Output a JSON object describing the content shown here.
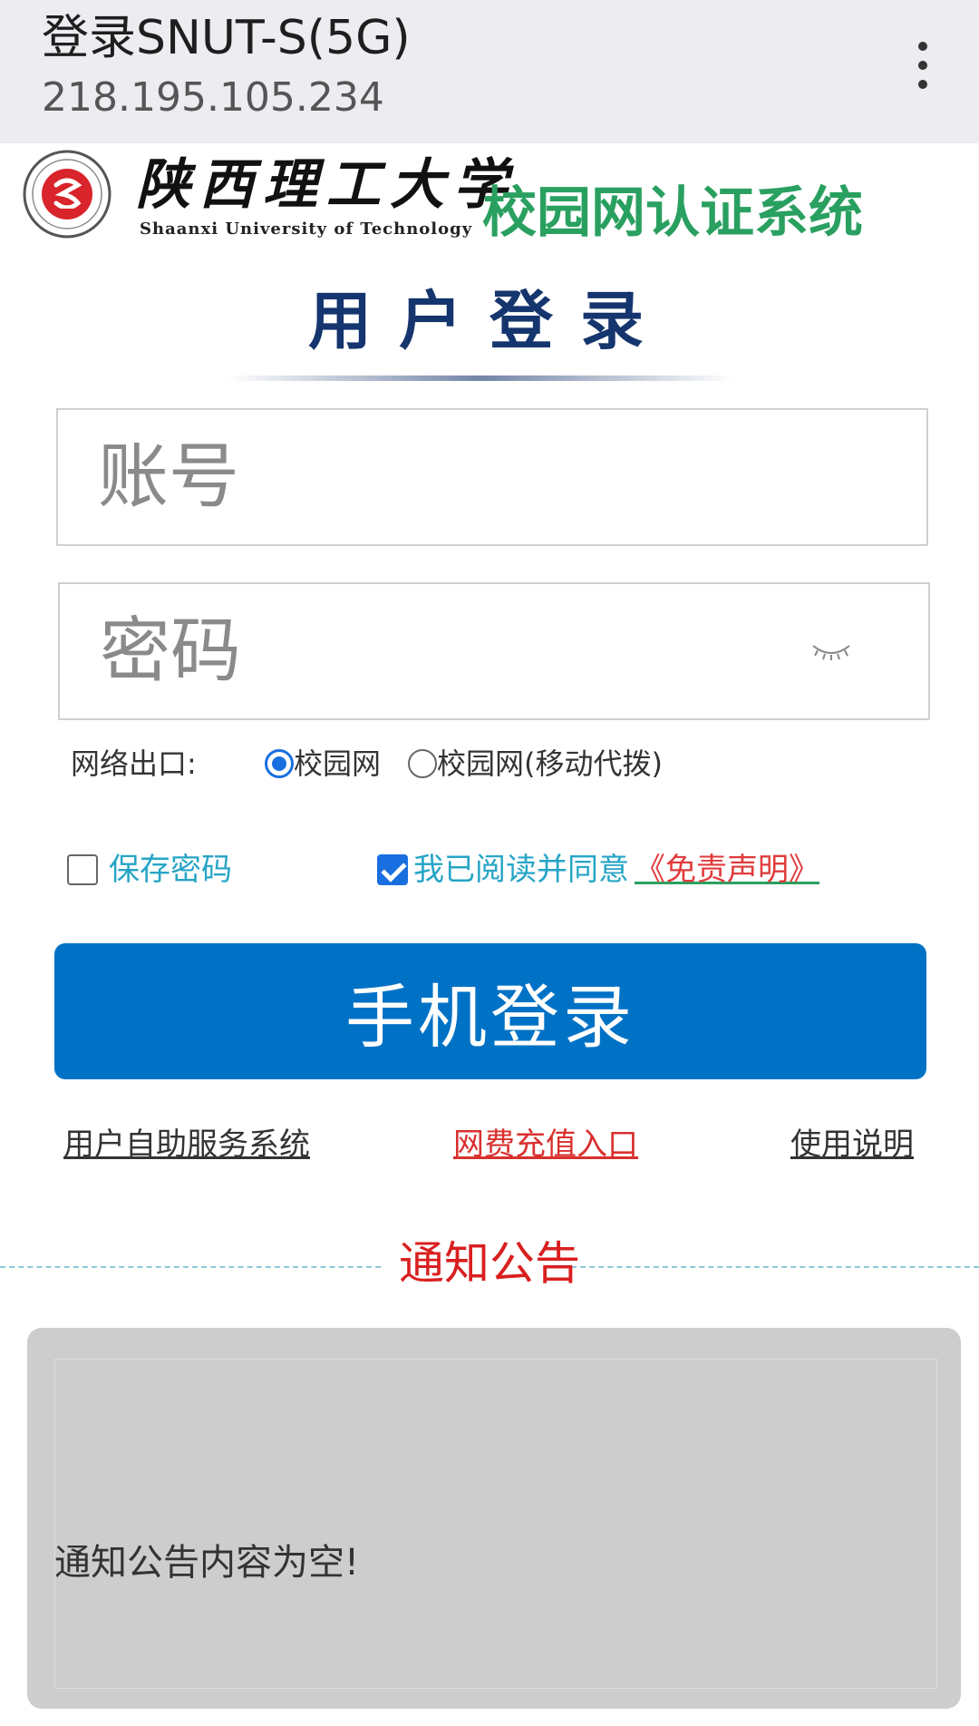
{
  "browser": {
    "title": "登录SNUT-S(5G)",
    "url": "218.195.105.234",
    "menu_icon": "more-vertical-icon"
  },
  "brand": {
    "logo_icon": "university-seal-icon",
    "university_cn": "陕西理工大学",
    "university_en": "Shaanxi University of Technology",
    "system_title": "校园网认证系统",
    "accent_color": "#2aa060"
  },
  "login": {
    "title": "用户登录",
    "account_placeholder": "账号",
    "password_placeholder": "密码",
    "password_toggle_icon": "eye-closed-icon",
    "network_label": "网络出口:",
    "network_options": [
      {
        "label": "校园网",
        "selected": true
      },
      {
        "label": "校园网(移动代拨)",
        "selected": false
      }
    ],
    "save_password_label": "保存密码",
    "save_password_checked": false,
    "agree_label": "我已阅读并同意",
    "agree_checked": true,
    "disclaimer_link": "《免责声明》",
    "submit_label": "手机登录",
    "button_color": "#0072c6"
  },
  "links": {
    "self_service": "用户自助服务系统",
    "recharge": "网费充值入口",
    "manual": "使用说明"
  },
  "notice": {
    "title": "通知公告",
    "content": "通知公告内容为空!"
  }
}
